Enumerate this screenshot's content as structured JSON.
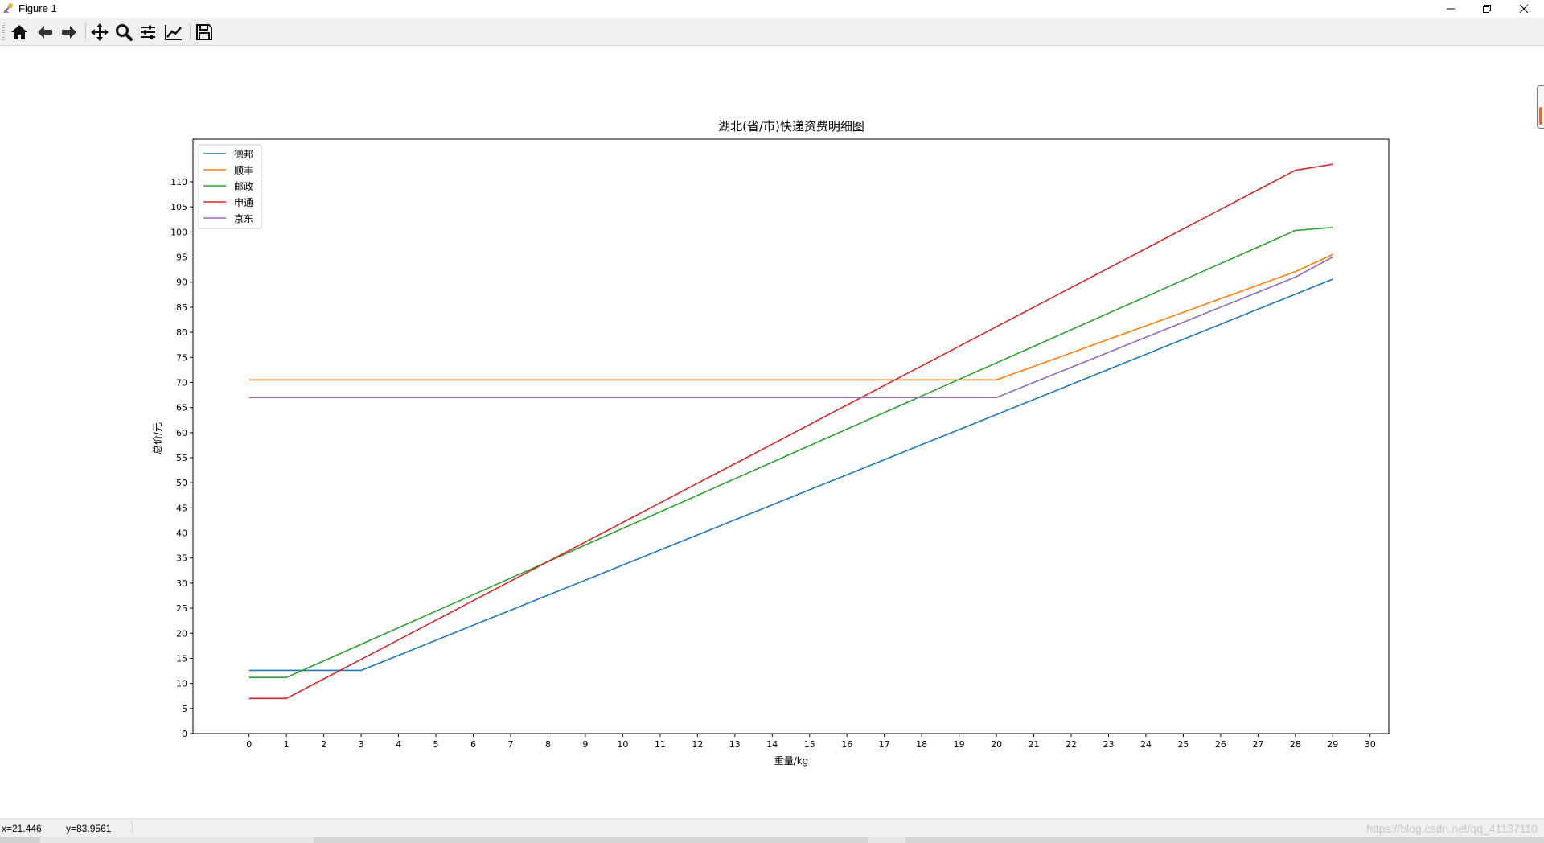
{
  "window": {
    "title": "Figure 1"
  },
  "toolbar": {
    "buttons": [
      {
        "name": "home-icon"
      },
      {
        "name": "back-icon"
      },
      {
        "name": "forward-icon"
      },
      {
        "name": "pan-icon"
      },
      {
        "name": "zoom-icon"
      },
      {
        "name": "subplots-icon"
      },
      {
        "name": "edit-axis-icon"
      },
      {
        "name": "save-icon"
      }
    ]
  },
  "status": {
    "x": "x=21.446",
    "y": "y=83.9561",
    "watermark": "https://blog.csdn.net/qq_41137110"
  },
  "colors": {
    "deb": "#1f77b4",
    "sf": "#ff7f0e",
    "youzheng": "#2ca02c",
    "shentong": "#d62728",
    "jd": "#9467bd"
  },
  "chart_data": {
    "type": "line",
    "title": "湖北(省/市)快递资费明细图",
    "xlabel": "重量/kg",
    "ylabel": "总价/元",
    "xlim": [
      -1.5,
      30.5
    ],
    "ylim": [
      0,
      118.5
    ],
    "xticks": [
      0,
      1,
      2,
      3,
      4,
      5,
      6,
      7,
      8,
      9,
      10,
      11,
      12,
      13,
      14,
      15,
      16,
      17,
      18,
      19,
      20,
      21,
      22,
      23,
      24,
      25,
      26,
      27,
      28,
      29,
      30
    ],
    "yticks": [
      0,
      5,
      10,
      15,
      20,
      25,
      30,
      35,
      40,
      45,
      50,
      55,
      60,
      65,
      70,
      75,
      80,
      85,
      90,
      95,
      100,
      105,
      110
    ],
    "grid": false,
    "legend_position": "top-left",
    "series": [
      {
        "name": "德邦",
        "color": "#1f77b4",
        "x": [
          0,
          1,
          2,
          3,
          4,
          5,
          6,
          7,
          8,
          9,
          10,
          11,
          12,
          13,
          14,
          15,
          16,
          17,
          18,
          19,
          20,
          21,
          22,
          23,
          24,
          25,
          26,
          27,
          28,
          29
        ],
        "y": [
          12.6,
          12.6,
          12.6,
          12.6,
          15.6,
          18.6,
          21.6,
          24.6,
          27.6,
          30.6,
          33.6,
          36.6,
          39.6,
          42.6,
          45.6,
          48.6,
          51.6,
          54.6,
          57.6,
          60.6,
          63.6,
          66.6,
          69.6,
          72.6,
          75.6,
          78.6,
          81.6,
          84.6,
          87.6,
          90.6
        ]
      },
      {
        "name": "顺丰",
        "color": "#ff7f0e",
        "x": [
          0,
          1,
          2,
          3,
          4,
          5,
          6,
          7,
          8,
          9,
          10,
          11,
          12,
          13,
          14,
          15,
          16,
          17,
          18,
          19,
          20,
          21,
          22,
          23,
          24,
          25,
          26,
          27,
          28,
          29
        ],
        "y": [
          70.5,
          70.5,
          70.5,
          70.5,
          70.5,
          70.5,
          70.5,
          70.5,
          70.5,
          70.5,
          70.5,
          70.5,
          70.5,
          70.5,
          70.5,
          70.5,
          70.5,
          70.5,
          70.5,
          70.5,
          70.5,
          73.2,
          75.9,
          78.6,
          81.3,
          84.0,
          86.7,
          89.4,
          92.1,
          95.5
        ]
      },
      {
        "name": "邮政",
        "color": "#2ca02c",
        "x": [
          0,
          1,
          2,
          3,
          4,
          5,
          6,
          7,
          8,
          9,
          10,
          11,
          12,
          13,
          14,
          15,
          16,
          17,
          18,
          19,
          20,
          21,
          22,
          23,
          24,
          25,
          26,
          27,
          28,
          29
        ],
        "y": [
          11.2,
          11.2,
          14.5,
          17.8,
          21.1,
          24.4,
          27.7,
          31.0,
          34.3,
          37.6,
          40.9,
          44.2,
          47.5,
          50.8,
          54.1,
          57.4,
          60.7,
          64.0,
          67.3,
          70.6,
          73.9,
          77.2,
          80.5,
          83.8,
          87.1,
          90.4,
          93.7,
          97.0,
          100.3,
          100.9
        ]
      },
      {
        "name": "申通",
        "color": "#d62728",
        "x": [
          0,
          1,
          2,
          3,
          4,
          5,
          6,
          7,
          8,
          9,
          10,
          11,
          12,
          13,
          14,
          15,
          16,
          17,
          18,
          19,
          20,
          21,
          22,
          23,
          24,
          25,
          26,
          27,
          28,
          29
        ],
        "y": [
          7.0,
          7.0,
          10.9,
          14.8,
          18.7,
          22.6,
          26.5,
          30.4,
          34.3,
          38.2,
          42.1,
          46.0,
          49.9,
          53.8,
          57.7,
          61.6,
          65.5,
          69.4,
          73.3,
          77.2,
          81.1,
          85.0,
          88.9,
          92.8,
          96.7,
          100.6,
          104.5,
          108.4,
          112.3,
          113.5
        ]
      },
      {
        "name": "京东",
        "color": "#9467bd",
        "x": [
          0,
          1,
          2,
          3,
          4,
          5,
          6,
          7,
          8,
          9,
          10,
          11,
          12,
          13,
          14,
          15,
          16,
          17,
          18,
          19,
          20,
          21,
          22,
          23,
          24,
          25,
          26,
          27,
          28,
          29
        ],
        "y": [
          67.0,
          67.0,
          67.0,
          67.0,
          67.0,
          67.0,
          67.0,
          67.0,
          67.0,
          67.0,
          67.0,
          67.0,
          67.0,
          67.0,
          67.0,
          67.0,
          67.0,
          67.0,
          67.0,
          67.0,
          67.0,
          70.0,
          73.0,
          76.0,
          79.0,
          82.0,
          85.0,
          88.0,
          91.0,
          95.0
        ]
      }
    ]
  }
}
